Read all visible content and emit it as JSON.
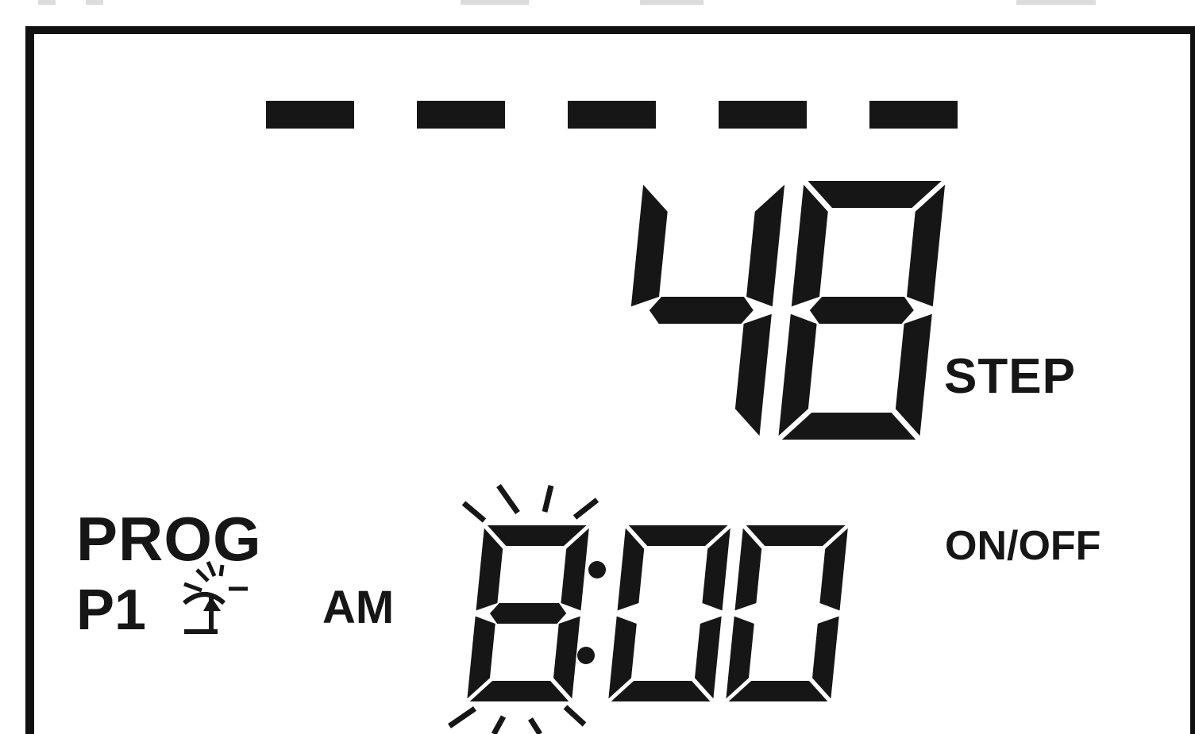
{
  "display": {
    "dashes": 5,
    "step_value": "48",
    "step_label": "STEP",
    "prog_label": "PROG",
    "program_label": "P1",
    "sun_icon": "sun-icon",
    "am_label": "AM",
    "time_value": "8:00",
    "blinking": "hour",
    "onoff_label": "ON/OFF"
  },
  "colors": {
    "segment": "#161616",
    "background": "#ffffff",
    "frame": "#111111"
  }
}
